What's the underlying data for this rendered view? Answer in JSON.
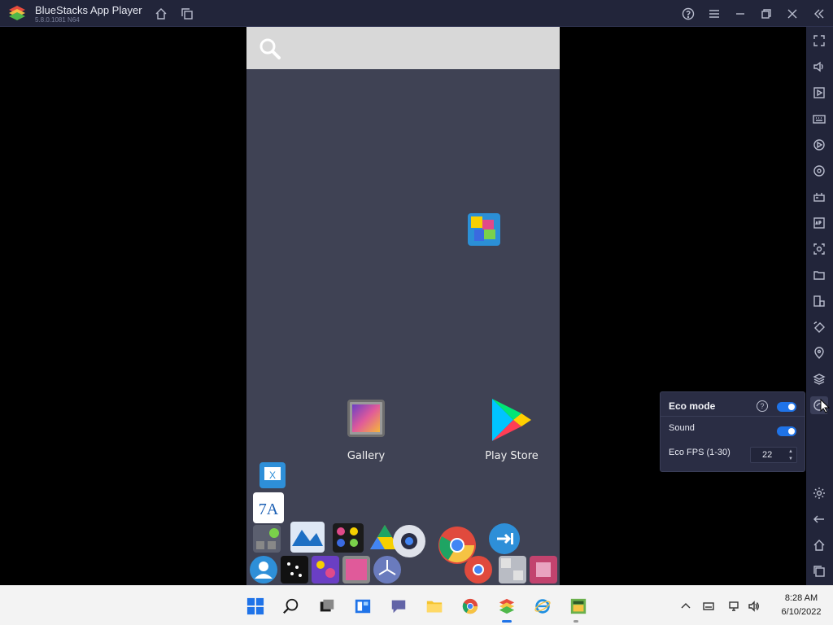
{
  "window": {
    "title": "BlueStacks App Player",
    "version": "5.8.0.1081 N64"
  },
  "colors": {
    "titlebar": "#22253a",
    "screen": "#3f4254",
    "accent": "#1f73e8",
    "taskbar": "#f3f3f3"
  },
  "home_screen": {
    "apps": [
      {
        "label": "Gallery",
        "icon": "gallery-icon"
      },
      {
        "label": "Play Store",
        "icon": "play-store-icon"
      }
    ]
  },
  "eco_panel": {
    "title": "Eco mode",
    "help": "?",
    "eco_enabled": true,
    "sound_label": "Sound",
    "sound_enabled": true,
    "fps_label": "Eco FPS (1-30)",
    "fps_value": "22"
  },
  "sidebar": {
    "icons": [
      "fullscreen-icon",
      "volume-icon",
      "media-manager-icon",
      "keyboard-icon",
      "macro-icon",
      "sync-icon",
      "gamepad-icon",
      "apk-icon",
      "screenshot-icon",
      "folder-icon",
      "multi-instance-icon",
      "rotate-icon",
      "location-icon",
      "layers-icon",
      "eco-mode-icon",
      "settings-icon",
      "back-icon",
      "home-icon",
      "recent-apps-icon"
    ]
  },
  "taskbar": {
    "time": "8:28 AM",
    "date": "6/10/2022"
  }
}
